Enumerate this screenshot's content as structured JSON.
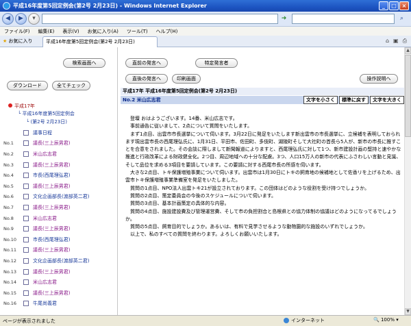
{
  "window": {
    "title": "平成16年度第5回定例会(第2号 2月23日) - Windows Internet Explorer",
    "controls": [
      "_",
      "□",
      "×"
    ]
  },
  "menu": [
    "ファイル(F)",
    "編集(E)",
    "表示(V)",
    "お気に入り(A)",
    "ツール(T)",
    "ヘルプ(H)"
  ],
  "tabs": {
    "favorites": "お気に入り",
    "active": "平成16年度第5回定例会(第2号 2月23日)"
  },
  "left": {
    "buttons": {
      "search": "検索画面へ",
      "download": "ダウンロード",
      "check_all": "全てチェック"
    },
    "tree": {
      "year": "平成17年",
      "session": "平成16年度第5回定例会",
      "issue": "(第2号 2月23日)"
    },
    "items": [
      {
        "no": "",
        "label": "議事日程",
        "color": "#1a3a9a"
      },
      {
        "no": "No.1",
        "label": "議長(三上辰男君)",
        "color": "#8a1a8a"
      },
      {
        "no": "No.2",
        "label": "米山広志君",
        "color": "#8a1a8a"
      },
      {
        "no": "No.3",
        "label": "議長(三上辰男君)",
        "color": "#8a1a8a"
      },
      {
        "no": "No.4",
        "label": "市長(西尾理弘君)",
        "color": "#1a3a9a"
      },
      {
        "no": "No.5",
        "label": "議長(三上辰男君)",
        "color": "#8a1a8a"
      },
      {
        "no": "No.6",
        "label": "文化企画部長(渡部英二君)",
        "color": "#1a3a9a"
      },
      {
        "no": "No.7",
        "label": "議長(三上辰男君)",
        "color": "#8a1a8a"
      },
      {
        "no": "No.8",
        "label": "米山広志君",
        "color": "#8a1a8a"
      },
      {
        "no": "No.9",
        "label": "議長(三上辰男君)",
        "color": "#8a1a8a"
      },
      {
        "no": "No.10",
        "label": "市長(西尾理弘君)",
        "color": "#1a3a9a"
      },
      {
        "no": "No.11",
        "label": "議長(三上辰男君)",
        "color": "#8a1a8a"
      },
      {
        "no": "No.12",
        "label": "文化企画部長(渡部英二君)",
        "color": "#1a3a9a"
      },
      {
        "no": "No.13",
        "label": "議長(三上辰男君)",
        "color": "#8a1a8a"
      },
      {
        "no": "No.14",
        "label": "米山広志君",
        "color": "#8a1a8a"
      },
      {
        "no": "No.15",
        "label": "議長(三上辰男君)",
        "color": "#8a1a8a"
      },
      {
        "no": "No.16",
        "label": "牛尾尚義君",
        "color": "#1a3a9a"
      }
    ]
  },
  "right": {
    "buttons": {
      "prev_speech": "直前の発言へ",
      "specific_speaker": "特定発言者",
      "next_speech": "直後の発言へ",
      "print_screen": "印刷画面",
      "help": "操作説明へ"
    },
    "header": "平成17年 平成16年度第5回定例会(第2号 2月23日)",
    "speaker": "No.2 米山広志君",
    "size_buttons": [
      "文字を小さく",
      "標準に戻す",
      "文字を大きく"
    ],
    "paragraphs": [
      "登壇 おはようございます。14番、米山広志です。",
      "事前通告に従いまして、2点について質問をいたします。",
      "まず1点目、出雲市市長選挙について伺います。3月22日に発足をいたします新出雲市の市長選挙に、立候補を表明しておられます現出雲市長の西尾理弘氏に、1月31日、平田市、佐田町、多伎町、湖陵町そして大社町の首長ら5人が、新市の市長に推すことを合意をされました。その会談に際しまして新聞報道によりますと、西尾理弘氏に対して1つ、新市建設計画の堅持と速やかな推進と行政改革による財政健全化。2つ目、周辺地域への十分な配慮。3つ、人口15万人の新市の代表にふさわしい言動と見識、そして品位を求める3項目を要請しています。この要請に対する西尾市長の所感を伺います。",
      "大きな2点目、トキ保護増殖事業について伺います。出雲市は1月30日にトキの飼育地の候補地として佐香リを上げるため、出雲市トキ保護増殖事業準備室を発足をいたしました。",
      "質問の1点目、NPO法人出雲トキ21が設立されております。この団体はどのような役割を受け持つでしょうか。",
      "質問の2点目、策定委員会の今後のスケジュールについて伺います。",
      "質問の3点目、基本計画策定の具体的な内容。",
      "質問の4点目、施設建設費及び管理運営費、そして市の負担割合と島根県との協力体制の協議はどのようになってるでしょうか。",
      "質問の5点目、飼育目的でしょうか。あるいは、有料で見学させるような動物園的な施設のいずれでしょうか。",
      "以上で、私のすべての質問を終わります。よろしくお願いいたします。"
    ]
  },
  "status": {
    "text": "ページが表示されました",
    "zone": "インターネット",
    "zoom": "100%"
  }
}
